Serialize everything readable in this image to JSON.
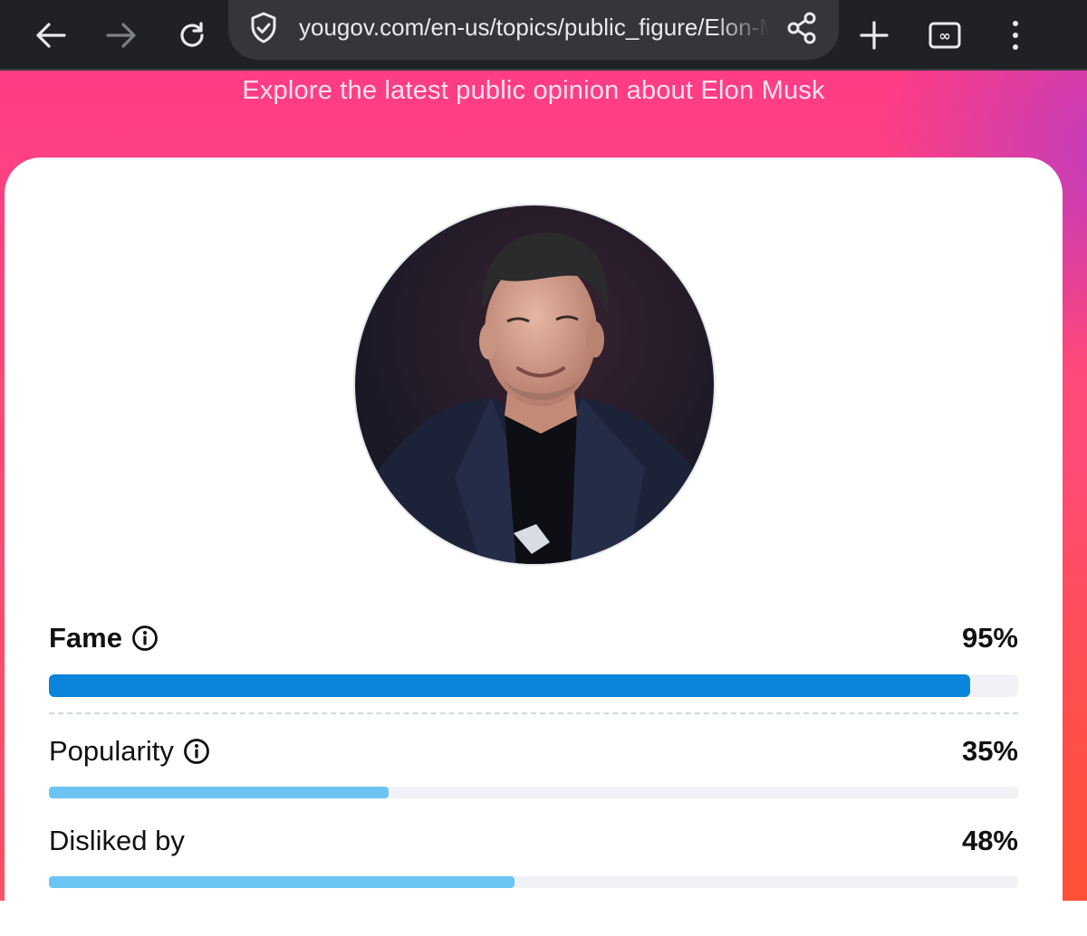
{
  "browser": {
    "url": "yougov.com/en-us/topics/public_figure/Elon-Musk",
    "icons": {
      "back": "back-arrow-icon",
      "forward": "forward-arrow-icon",
      "reload": "reload-icon",
      "security": "shield-check-icon",
      "share": "share-icon",
      "new_tab": "plus-icon",
      "tabs": "tab-switcher-icon",
      "tabs_count": "∞",
      "menu": "more-vert-icon"
    }
  },
  "header": {
    "subtitle": "Explore the latest public opinion about Elon Musk"
  },
  "profile": {
    "photo": "public-figure-photo"
  },
  "metrics": [
    {
      "label": "Fame",
      "value": "95%",
      "fraction": 0.95,
      "bold_label": true,
      "has_info": true,
      "bar_color": "#0a85da"
    },
    {
      "label": "Popularity",
      "value": "35%",
      "fraction": 0.35,
      "bold_label": false,
      "has_info": true,
      "bar_color": "#6cc4f3"
    },
    {
      "label": "Disliked by",
      "value": "48%",
      "fraction": 0.48,
      "bold_label": false,
      "has_info": false,
      "bar_color": "#6cc4f3"
    }
  ],
  "colors": {
    "toolbar_bg": "#202124",
    "urlbar_bg": "#35363a",
    "page_pink": "#ff3c86",
    "track": "#f1f2f5"
  }
}
